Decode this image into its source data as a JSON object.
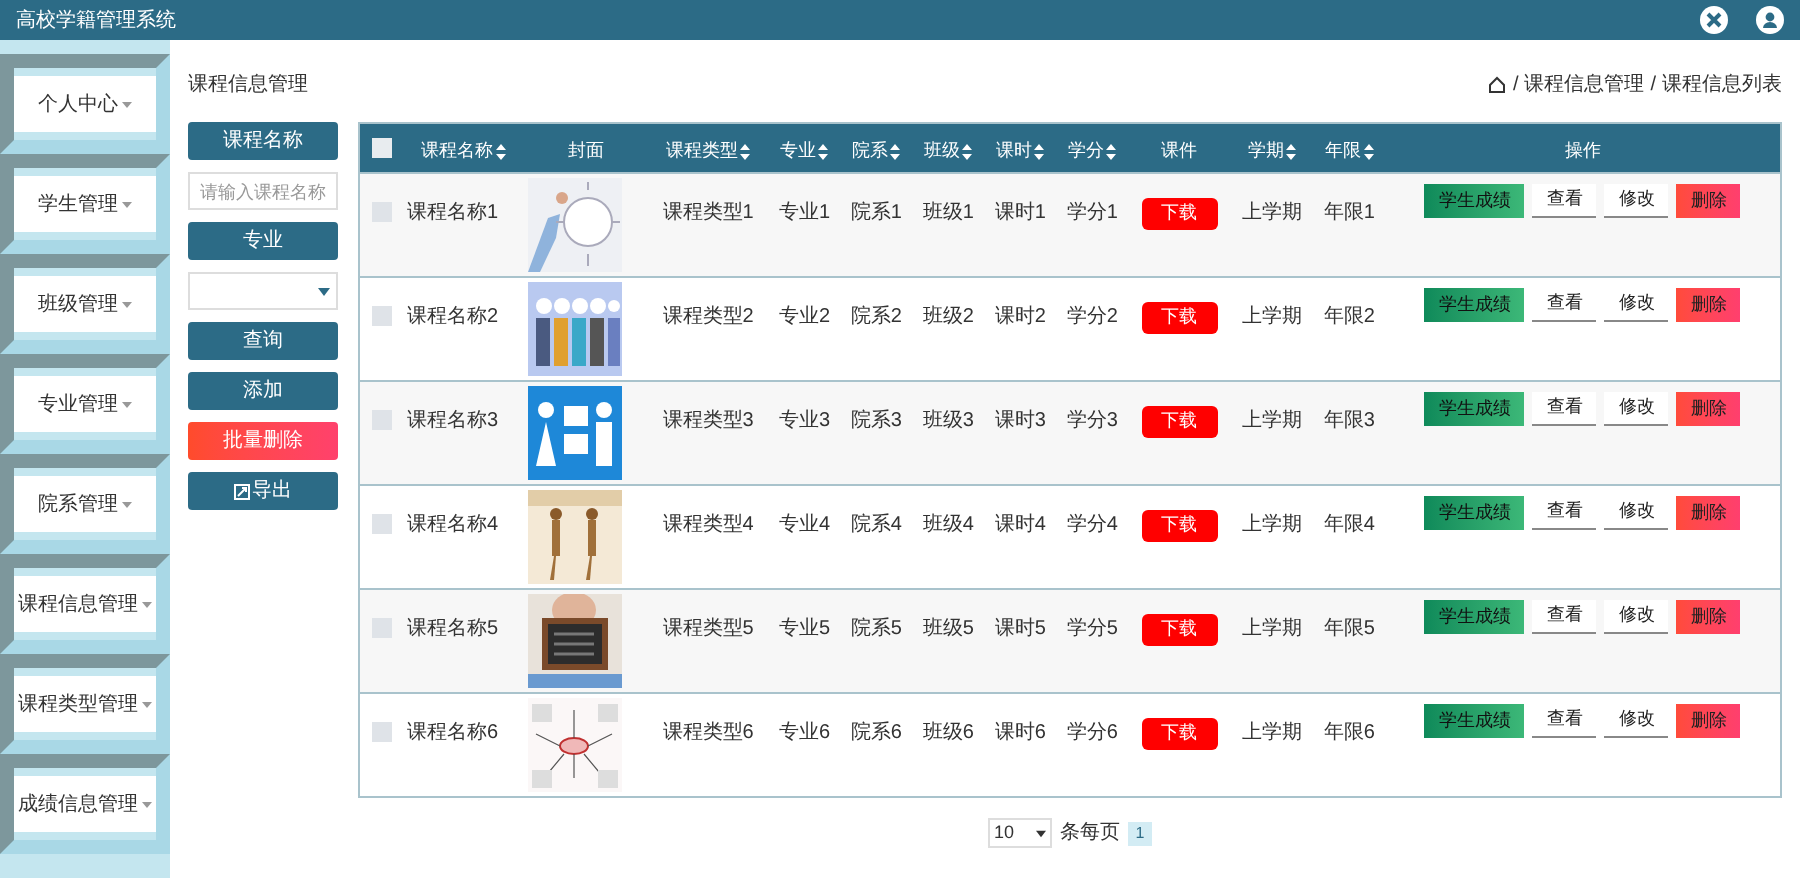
{
  "header": {
    "title": "高校学籍管理系统"
  },
  "sidebar": {
    "items": [
      {
        "label": "个人中心"
      },
      {
        "label": "学生管理"
      },
      {
        "label": "班级管理"
      },
      {
        "label": "专业管理"
      },
      {
        "label": "院系管理"
      },
      {
        "label": "课程信息管理"
      },
      {
        "label": "课程类型管理"
      },
      {
        "label": "成绩信息管理"
      }
    ]
  },
  "page_title": "课程信息管理",
  "breadcrumb": {
    "separator": "/",
    "items": [
      "课程信息管理",
      "课程信息列表"
    ]
  },
  "filters": {
    "name_label": "课程名称",
    "name_placeholder": "请输入课程名称",
    "major_label": "专业",
    "search_button": "查询",
    "add_button": "添加",
    "batch_delete_button": "批量删除",
    "export_button": "导出"
  },
  "table": {
    "select_all": false,
    "columns": [
      {
        "label": "课程名称",
        "sortable": true
      },
      {
        "label": "封面",
        "sortable": false
      },
      {
        "label": "课程类型",
        "sortable": true
      },
      {
        "label": "专业",
        "sortable": true
      },
      {
        "label": "院系",
        "sortable": true
      },
      {
        "label": "班级",
        "sortable": true
      },
      {
        "label": "课时",
        "sortable": true
      },
      {
        "label": "学分",
        "sortable": true
      },
      {
        "label": "课件",
        "sortable": false
      },
      {
        "label": "学期",
        "sortable": true
      },
      {
        "label": "年限",
        "sortable": true
      },
      {
        "label": "操作",
        "sortable": false
      }
    ],
    "rows": [
      {
        "checked": false,
        "name": "课程名称1",
        "type": "课程类型1",
        "major": "专业1",
        "dept": "院系1",
        "class": "班级1",
        "hours": "课时1",
        "credit": "学分1",
        "download": "下载",
        "semester": "上学期",
        "years": "年限1",
        "actions": [
          "学生成绩",
          "查看",
          "修改",
          "删除"
        ]
      },
      {
        "checked": false,
        "name": "课程名称2",
        "type": "课程类型2",
        "major": "专业2",
        "dept": "院系2",
        "class": "班级2",
        "hours": "课时2",
        "credit": "学分2",
        "download": "下载",
        "semester": "上学期",
        "years": "年限2",
        "actions": [
          "学生成绩",
          "查看",
          "修改",
          "删除"
        ]
      },
      {
        "checked": false,
        "name": "课程名称3",
        "type": "课程类型3",
        "major": "专业3",
        "dept": "院系3",
        "class": "班级3",
        "hours": "课时3",
        "credit": "学分3",
        "download": "下载",
        "semester": "上学期",
        "years": "年限3",
        "actions": [
          "学生成绩",
          "查看",
          "修改",
          "删除"
        ]
      },
      {
        "checked": false,
        "name": "课程名称4",
        "type": "课程类型4",
        "major": "专业4",
        "dept": "院系4",
        "class": "班级4",
        "hours": "课时4",
        "credit": "学分4",
        "download": "下载",
        "semester": "上学期",
        "years": "年限4",
        "actions": [
          "学生成绩",
          "查看",
          "修改",
          "删除"
        ]
      },
      {
        "checked": false,
        "name": "课程名称5",
        "type": "课程类型5",
        "major": "专业5",
        "dept": "院系5",
        "class": "班级5",
        "hours": "课时5",
        "credit": "学分5",
        "download": "下载",
        "semester": "上学期",
        "years": "年限5",
        "actions": [
          "学生成绩",
          "查看",
          "修改",
          "删除"
        ]
      },
      {
        "checked": false,
        "name": "课程名称6",
        "type": "课程类型6",
        "major": "专业6",
        "dept": "院系6",
        "class": "班级6",
        "hours": "课时6",
        "credit": "学分6",
        "download": "下载",
        "semester": "上学期",
        "years": "年限6",
        "actions": [
          "学生成绩",
          "查看",
          "修改",
          "删除"
        ]
      }
    ]
  },
  "pagination": {
    "page_size": "10",
    "page_size_label": "条每页",
    "pages": [
      {
        "label": "1",
        "selected": true
      }
    ]
  }
}
